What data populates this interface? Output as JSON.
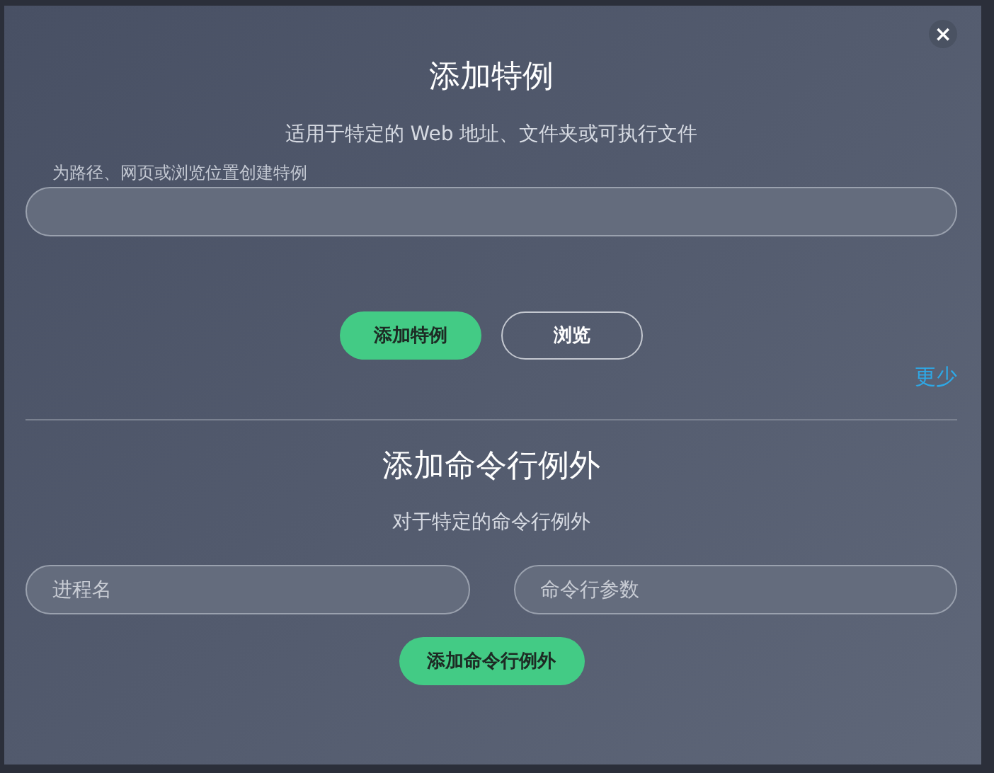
{
  "dialog": {
    "close": "×"
  },
  "exception": {
    "title": "添加特例",
    "subtitle": "适用于特定的 Web 地址、文件夹或可执行文件",
    "field_label": "为路径、网页或浏览位置创建特例",
    "buttons": [
      {
        "label": "添加特例",
        "kind": "primary"
      },
      {
        "label": "浏览",
        "kind": "outline"
      }
    ],
    "toggle_link": "更少"
  },
  "command_line": {
    "title": "添加命令行例外",
    "subtitle": "对于特定的命令行例外",
    "fields": [
      {
        "placeholder": "进程名"
      },
      {
        "placeholder": "命令行参数"
      }
    ],
    "buttons": [
      {
        "label": "添加命令行例外",
        "kind": "primary"
      }
    ]
  }
}
